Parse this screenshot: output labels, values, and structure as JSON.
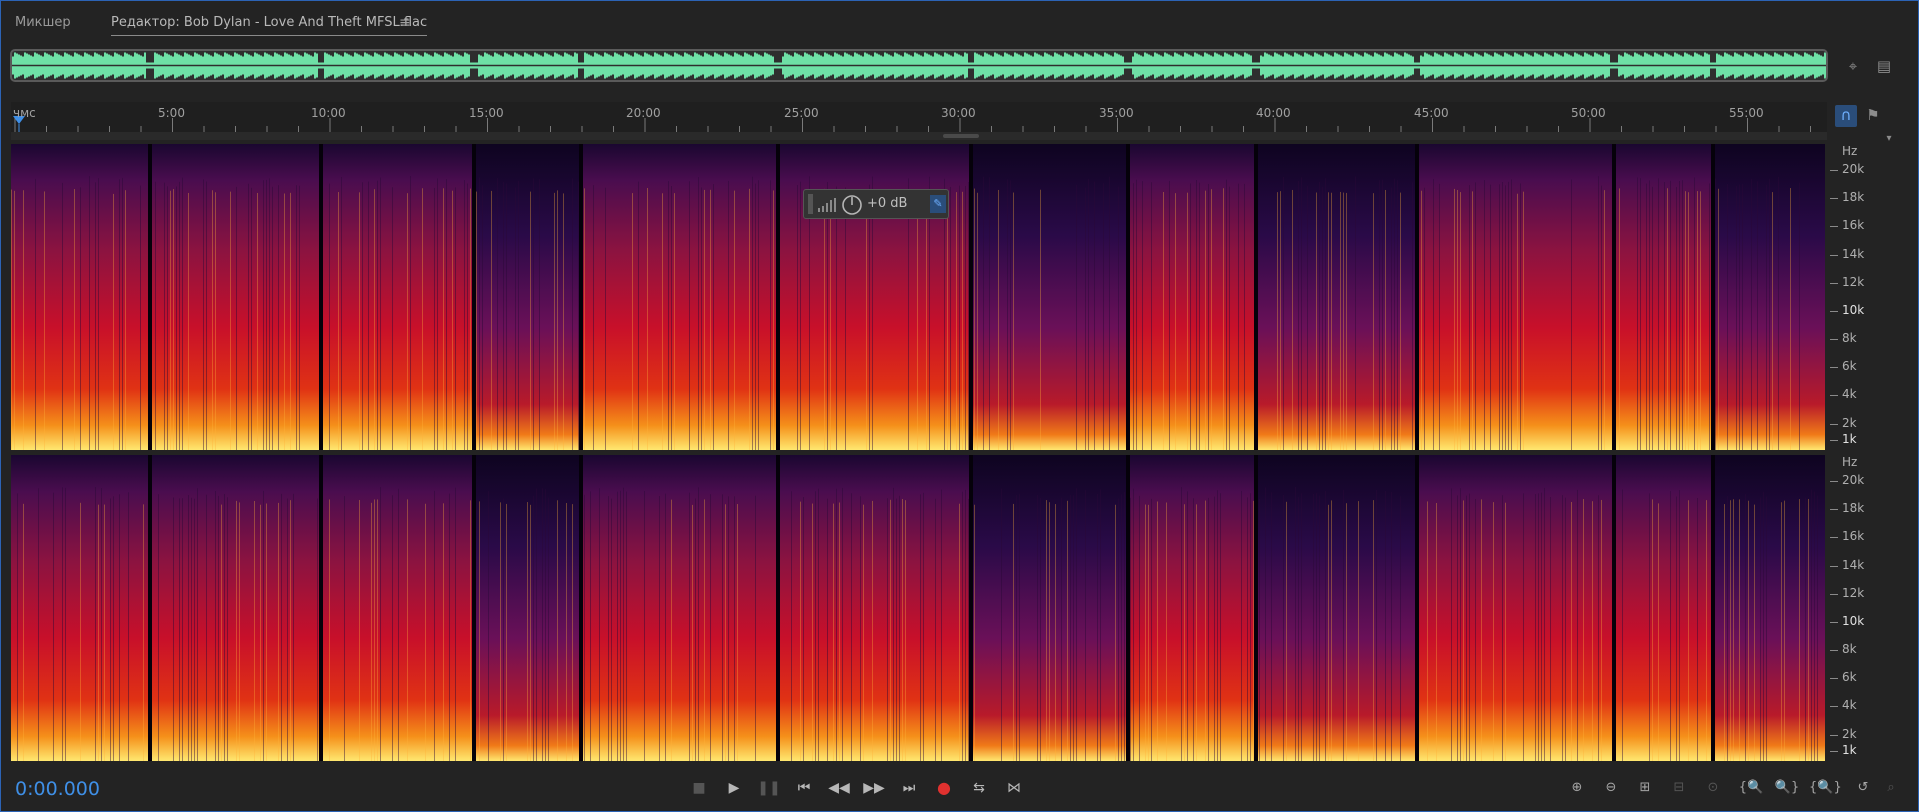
{
  "tabs": {
    "mixer": "Микшер",
    "editor": "Редактор: Bob Dylan - Love And Theft MFSL.flac",
    "menu_glyph": "≡"
  },
  "ruler": {
    "unit": "чмс",
    "labels": [
      "5:00",
      "10:00",
      "15:00",
      "20:00",
      "25:00",
      "30:00",
      "35:00",
      "40:00",
      "45:00",
      "50:00",
      "55:00"
    ]
  },
  "hz_scale": {
    "unit": "Hz",
    "labels": [
      "20k",
      "18k",
      "16k",
      "14k",
      "12k",
      "10k",
      "8k",
      "6k",
      "4k",
      "2k",
      "1k"
    ]
  },
  "hud": {
    "value": "+0 dB"
  },
  "time": "0:00.000",
  "colors": {
    "accent": "#3f8fe6",
    "waveform": "#6ee0a6",
    "record": "#e0312f"
  },
  "transport": {
    "stop": "stop-icon",
    "play": "play-icon",
    "pause": "pause-icon",
    "to_start": "skip-back-icon",
    "rewind": "rewind-icon",
    "forward": "fast-forward-icon",
    "to_end": "skip-forward-icon",
    "record": "record-icon",
    "loop": "loop-icon",
    "skip_selection": "skip-selection-icon"
  }
}
